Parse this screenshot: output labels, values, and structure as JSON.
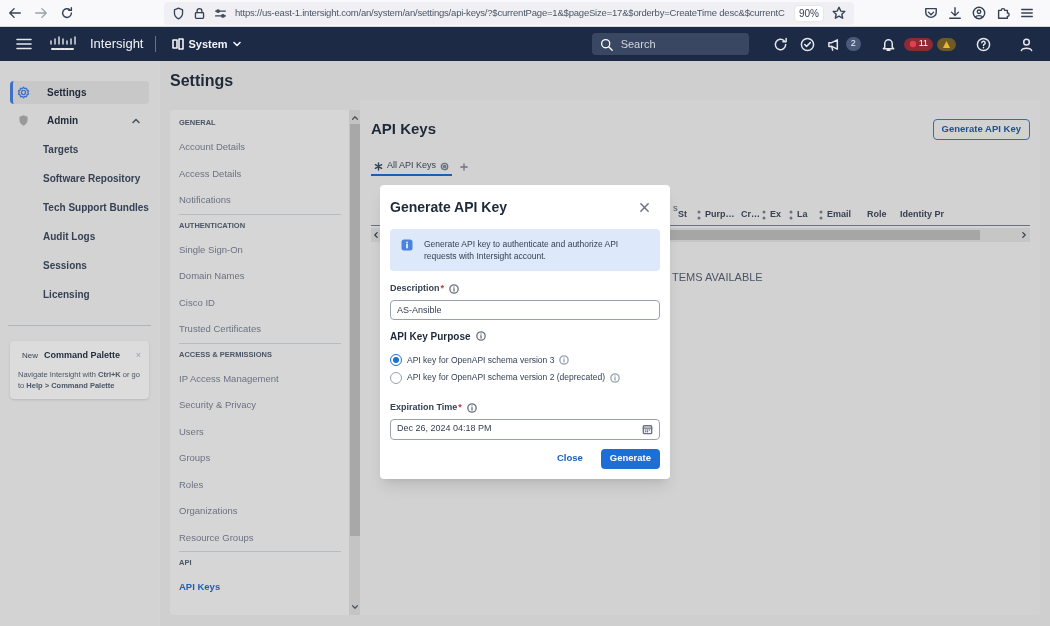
{
  "browser": {
    "url": "https://us-east-1.intersight.com/an/system/an/settings/api-keys/?$currentPage=1&$pageSize=17&$orderby=CreateTime desc&$currentC",
    "zoom": "90%"
  },
  "header": {
    "brand": "Intersight",
    "scope": "System",
    "search_placeholder": "Search",
    "announcements_count": "2",
    "critical_alarms_count": "11"
  },
  "sidebar": {
    "items": [
      {
        "label": "Settings",
        "selected": true
      },
      {
        "label": "Admin",
        "selected": false,
        "expanded": true,
        "children": [
          {
            "label": "Targets",
            "selected": false
          },
          {
            "label": "Software Repository",
            "selected": false
          },
          {
            "label": "Tech Support Bundles",
            "selected": false
          },
          {
            "label": "Audit Logs",
            "selected": false
          },
          {
            "label": "Sessions",
            "selected": false
          },
          {
            "label": "Licensing",
            "selected": false
          }
        ]
      }
    ]
  },
  "command_palette": {
    "badge": "New",
    "title": "Command Palette",
    "close": "×",
    "text": "Navigate Intersight with **Ctrl+K** or go to **Help > Command Palette**"
  },
  "page_title": "Settings",
  "settings_nav": [
    {
      "heading": "GENERAL",
      "items": [
        {
          "label": "Account Details",
          "selected": false
        },
        {
          "label": "Access Details",
          "selected": false
        },
        {
          "label": "Notifications",
          "selected": false
        }
      ]
    },
    {
      "heading": "AUTHENTICATION",
      "items": [
        {
          "label": "Single Sign-On",
          "selected": false
        },
        {
          "label": "Domain Names",
          "selected": false
        },
        {
          "label": "Cisco ID",
          "selected": false
        },
        {
          "label": "Trusted Certificates",
          "selected": false
        }
      ]
    },
    {
      "heading": "ACCESS & PERMISSIONS",
      "items": [
        {
          "label": "IP Access Management",
          "selected": false
        },
        {
          "label": "Security & Privacy",
          "selected": false
        },
        {
          "label": "Users",
          "selected": false
        },
        {
          "label": "Groups",
          "selected": false
        },
        {
          "label": "Roles",
          "selected": false
        },
        {
          "label": "Organizations",
          "selected": false
        },
        {
          "label": "Resource Groups",
          "selected": false
        }
      ]
    },
    {
      "heading": "API",
      "items": [
        {
          "label": "API Keys",
          "selected": true
        }
      ]
    }
  ],
  "api_keys": {
    "title": "API Keys",
    "generate_button": "Generate API Key",
    "tabs": [
      {
        "label": "All API Keys",
        "selected": true
      }
    ],
    "caption_fragment": "s",
    "columns": [
      {
        "label": "St",
        "sortable": true
      },
      {
        "label": "Purp…",
        "sortable": false
      },
      {
        "label": "Cr…",
        "sortable": true
      },
      {
        "label": "Ex",
        "sortable": true
      },
      {
        "label": "La",
        "sortable": true
      },
      {
        "label": "Email",
        "sortable": false
      },
      {
        "label": "Role",
        "sortable": false
      },
      {
        "label": "Identity Pr",
        "sortable": false
      }
    ],
    "empty_message": "TEMS AVAILABLE"
  },
  "dialog": {
    "title": "Generate API Key",
    "info": "Generate API key to authenticate and authorize API requests with Intersight account.",
    "description": {
      "label": "Description",
      "required_mark": "*",
      "value": "AS-Ansible"
    },
    "purpose": {
      "label": "API Key Purpose",
      "options": [
        {
          "label": "API key for OpenAPI schema version 3",
          "selected": true
        },
        {
          "label": "API key for OpenAPI schema version 2 (deprecated)",
          "selected": false
        }
      ]
    },
    "expiration": {
      "label": "Expiration Time",
      "required_mark": "*",
      "value": "Dec 26, 2024 04:18 PM"
    },
    "buttons": {
      "close": "Close",
      "generate": "Generate"
    }
  }
}
